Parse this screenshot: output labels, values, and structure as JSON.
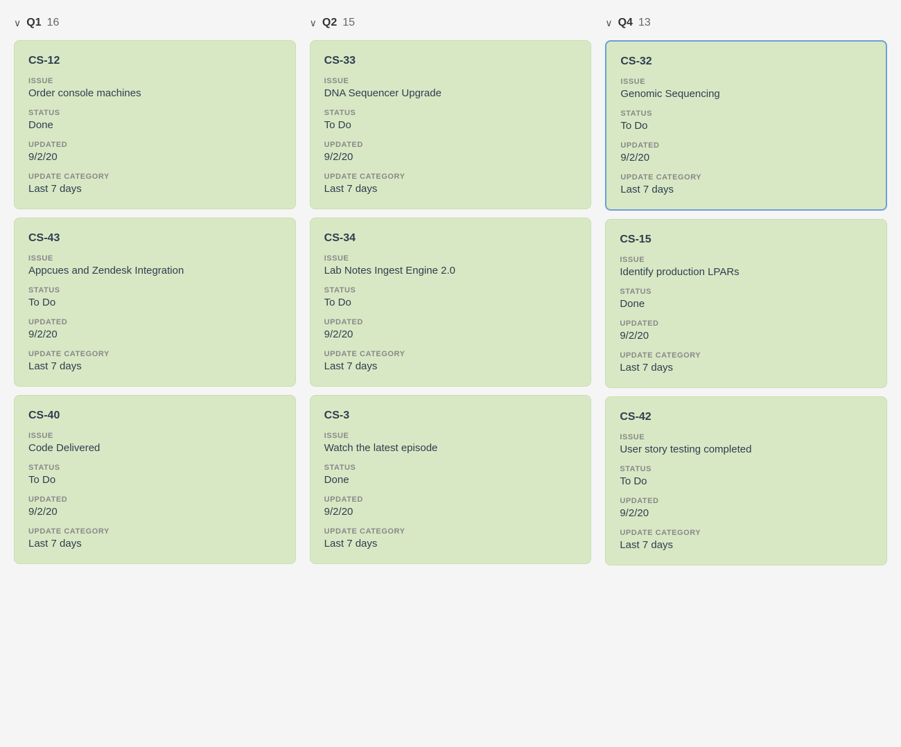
{
  "columns": [
    {
      "id": "q1",
      "label": "Q1",
      "count": "16",
      "cards": [
        {
          "id": "CS-12",
          "issue": "Order console machines",
          "status": "Done",
          "updated": "9/2/20",
          "updateCategory": "Last 7 days",
          "selected": false
        },
        {
          "id": "CS-43",
          "issue": "Appcues and Zendesk Integration",
          "status": "To Do",
          "updated": "9/2/20",
          "updateCategory": "Last 7 days",
          "selected": false
        },
        {
          "id": "CS-40",
          "issue": "Code Delivered",
          "status": "To Do",
          "updated": "9/2/20",
          "updateCategory": "Last 7 days",
          "selected": false
        }
      ]
    },
    {
      "id": "q2",
      "label": "Q2",
      "count": "15",
      "cards": [
        {
          "id": "CS-33",
          "issue": "DNA Sequencer Upgrade",
          "status": "To Do",
          "updated": "9/2/20",
          "updateCategory": "Last 7 days",
          "selected": false
        },
        {
          "id": "CS-34",
          "issue": "Lab Notes Ingest Engine 2.0",
          "status": "To Do",
          "updated": "9/2/20",
          "updateCategory": "Last 7 days",
          "selected": false
        },
        {
          "id": "CS-3",
          "issue": "Watch the latest episode",
          "status": "Done",
          "updated": "9/2/20",
          "updateCategory": "Last 7 days",
          "selected": false
        }
      ]
    },
    {
      "id": "q4",
      "label": "Q4",
      "count": "13",
      "cards": [
        {
          "id": "CS-32",
          "issue": "Genomic Sequencing",
          "status": "To Do",
          "updated": "9/2/20",
          "updateCategory": "Last 7 days",
          "selected": true
        },
        {
          "id": "CS-15",
          "issue": "Identify production LPARs",
          "status": "Done",
          "updated": "9/2/20",
          "updateCategory": "Last 7 days",
          "selected": false
        },
        {
          "id": "CS-42",
          "issue": "User story testing completed",
          "status": "To Do",
          "updated": "9/2/20",
          "updateCategory": "Last 7 days",
          "selected": false
        }
      ]
    }
  ],
  "labels": {
    "issue": "ISSUE",
    "status": "STATUS",
    "updated": "UPDATED",
    "updateCategory": "UPDATE CATEGORY"
  }
}
